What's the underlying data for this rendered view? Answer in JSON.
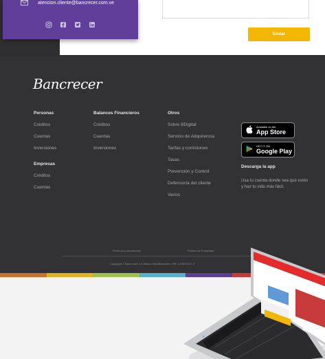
{
  "contact": {
    "email": "atencion.cliente@bancrecer.com.ve"
  },
  "form": {
    "send_label": "Enviar"
  },
  "social_icons": [
    "instagram-icon",
    "facebook-icon",
    "twitter-icon",
    "linkedin-icon"
  ],
  "brand": {
    "logo_text": "Bancrecer"
  },
  "footer": {
    "personas": {
      "title": "Personas",
      "items": [
        "Créditos",
        "Cuentas",
        "Inversiones"
      ]
    },
    "empresas": {
      "title": "Empresas",
      "items": [
        "Créditos",
        "Cuentas"
      ]
    },
    "balances": {
      "title": "Balances Financieros",
      "items": [
        "Créditos",
        "Cuentas",
        "Inversiones"
      ]
    },
    "otros": {
      "title": "Otros",
      "items": [
        "Sobre BDigital",
        "Servicio de Adquirencia",
        "Tarifas y comisiones",
        "Tasas",
        "Prevención y Control",
        "Defensoría del cliente",
        "Varios"
      ]
    },
    "app": {
      "appstore_small": "Available on the",
      "appstore_big": "App Store",
      "googleplay_small": "GET IT ON",
      "googleplay_big": "Google Play",
      "title": "Descarga la app",
      "text": "Usa tu cuenta donde sea que estés y haz tu vida más fácil."
    },
    "legal": {
      "terms": "Términos y condiciones",
      "privacy": "Política de Privacidad",
      "copyright": "Copyright © Bancrecer S.A Banco Microfinanciero, RIF J-31637417-3"
    }
  },
  "colors": {
    "purple": "#5f3f99",
    "yellow": "#f2b705",
    "footer_bg": "#323234",
    "stripes": [
      "#c7712a",
      "#e2b321",
      "#9fbf4f",
      "#53b2c7",
      "#5b3e93",
      "#c63a3a",
      "#c63a3a"
    ]
  }
}
